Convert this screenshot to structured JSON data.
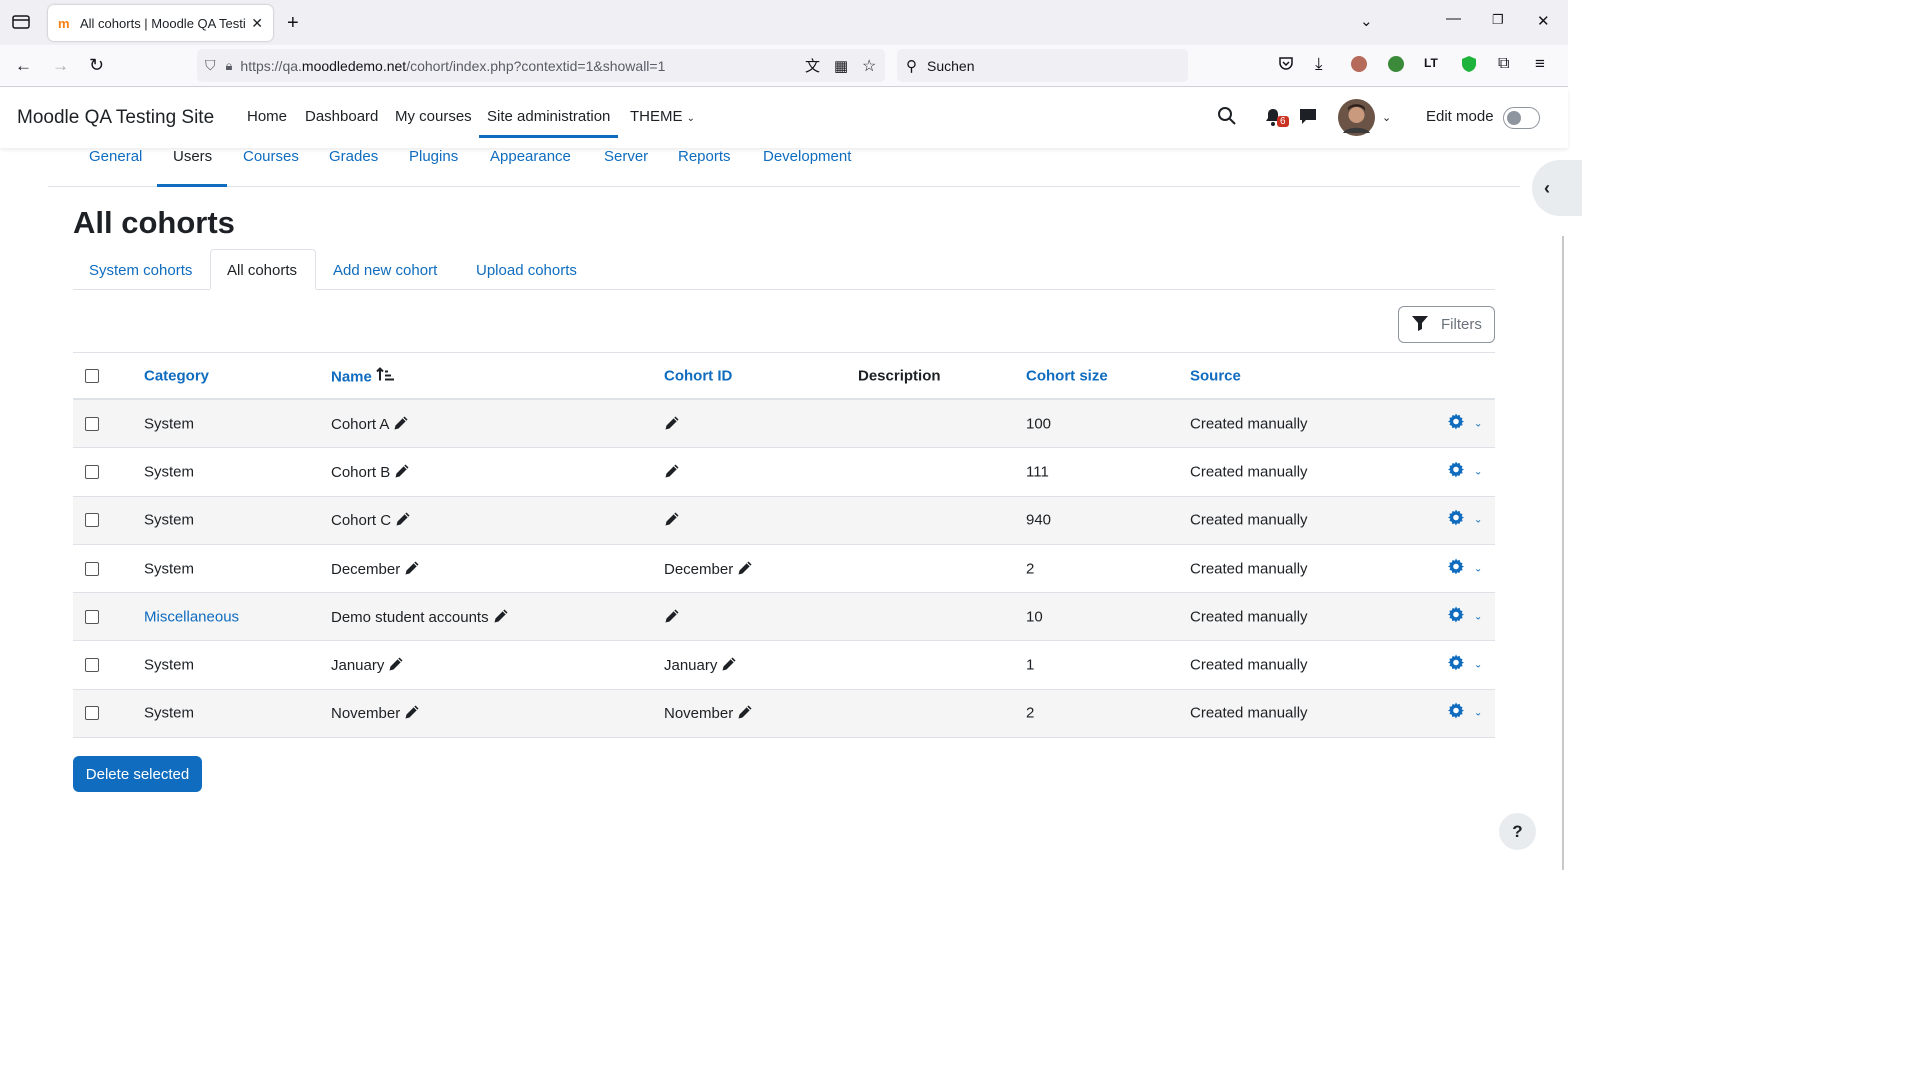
{
  "browser": {
    "tab_title": "All cohorts | Moodle QA Testing",
    "url_prefix": "https://qa.",
    "url_host": "moodledemo.net",
    "url_path": "/cohort/index.php?contextid=1&showall=1",
    "search_placeholder": "Suchen"
  },
  "header": {
    "site_name": "Moodle QA Testing Site",
    "nav": [
      "Home",
      "Dashboard",
      "My courses",
      "Site administration",
      "THEME"
    ],
    "notification_count": "6",
    "edit_mode_label": "Edit mode"
  },
  "secondary_nav": [
    "General",
    "Users",
    "Courses",
    "Grades",
    "Plugins",
    "Appearance",
    "Server",
    "Reports",
    "Development"
  ],
  "page": {
    "title": "All cohorts",
    "tabs": [
      "System cohorts",
      "All cohorts",
      "Add new cohort",
      "Upload cohorts"
    ],
    "filters_label": "Filters",
    "delete_label": "Delete selected",
    "help_label": "?"
  },
  "table": {
    "headers": [
      "Category",
      "Name",
      "Cohort ID",
      "Description",
      "Cohort size",
      "Source"
    ],
    "rows": [
      {
        "category": "System",
        "name": "Cohort A",
        "cohort_id": "",
        "size": "100",
        "source": "Created manually"
      },
      {
        "category": "System",
        "name": "Cohort B",
        "cohort_id": "",
        "size": "111",
        "source": "Created manually"
      },
      {
        "category": "System",
        "name": "Cohort C",
        "cohort_id": "",
        "size": "940",
        "source": "Created manually"
      },
      {
        "category": "System",
        "name": "December",
        "cohort_id": "December",
        "size": "2",
        "source": "Created manually"
      },
      {
        "category": "Miscellaneous",
        "name": "Demo student accounts",
        "cohort_id": "",
        "size": "10",
        "source": "Created manually"
      },
      {
        "category": "System",
        "name": "January",
        "cohort_id": "January",
        "size": "1",
        "source": "Created manually"
      },
      {
        "category": "System",
        "name": "November",
        "cohort_id": "November",
        "size": "2",
        "source": "Created manually"
      }
    ]
  },
  "colors": {
    "accent": "#0f6cbf"
  }
}
